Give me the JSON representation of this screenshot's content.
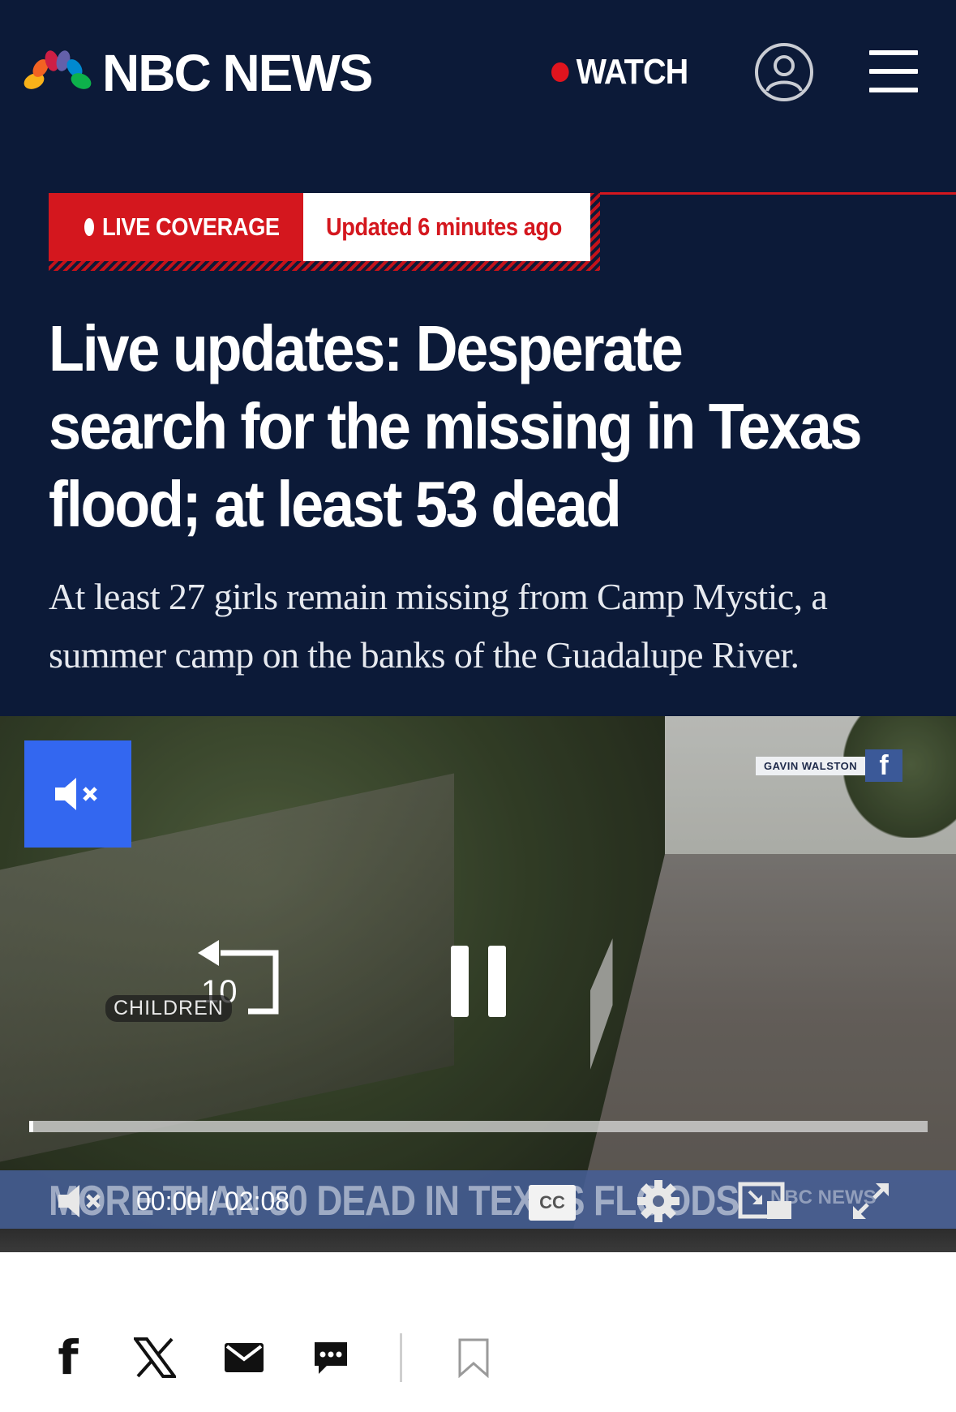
{
  "header": {
    "brand": "NBC NEWS",
    "watch_label": "WATCH",
    "account_icon": "account-icon",
    "menu_icon": "hamburger-menu-icon",
    "colors": {
      "navy": "#0c1a38",
      "red": "#d4171e"
    }
  },
  "live": {
    "badge": "LIVE COVERAGE",
    "updated": "Updated 6 minutes ago"
  },
  "article": {
    "headline_lines": [
      "Live updates: Desperate",
      "search for the missing in Texas",
      "flood; at least 53 dead"
    ],
    "dek": "At least 27 girls remain missing from Camp Mystic, a summer camp on the banks of the Guadalupe River."
  },
  "video": {
    "credit": "GAVIN WALSTON",
    "credit_icon": "facebook-icon",
    "rewind_seconds": "10",
    "caption_tag": "CHILDREN",
    "lower_third": "MORE THAN 50 DEAD IN TEXAS FLOODS",
    "lower_third_brand": "NBC NEWS",
    "current_time": "00:00",
    "separator": "/",
    "duration": "02:08",
    "cc_label": "CC",
    "progress_fraction": 0.0,
    "accent": "#3367f0"
  },
  "share": {
    "facebook_glyph": "f",
    "icons": [
      "facebook-icon",
      "x-icon",
      "mail-icon",
      "comment-icon",
      "bookmark-icon"
    ]
  }
}
